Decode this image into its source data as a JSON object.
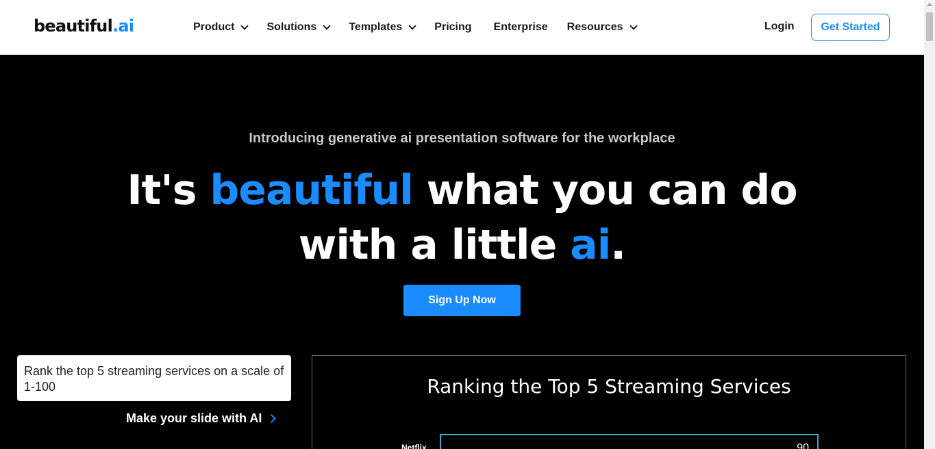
{
  "header": {
    "logo_main": "beautiful",
    "logo_dot": ".ai",
    "nav": [
      {
        "label": "Product",
        "dropdown": true
      },
      {
        "label": "Solutions",
        "dropdown": true
      },
      {
        "label": "Templates",
        "dropdown": true
      },
      {
        "label": "Pricing",
        "dropdown": false
      },
      {
        "label": "Enterprise",
        "dropdown": false
      },
      {
        "label": "Resources",
        "dropdown": true
      }
    ],
    "login_label": "Login",
    "get_started_label": "Get Started"
  },
  "hero": {
    "intro": "Introducing generative ai presentation software for the workplace",
    "headline_part1": "It's ",
    "headline_blue1": "beautiful",
    "headline_part2": " what you can do",
    "headline_part3": "with a little ",
    "headline_blue2": "ai",
    "headline_end": ".",
    "signup_label": "Sign Up Now"
  },
  "demo": {
    "prompt_text": "Rank the top 5 streaming services on a scale of 1-100",
    "make_slide_label": "Make your slide with AI",
    "slide_title": "Ranking the Top 5 Streaming Services",
    "first_bar_label": "Netflix",
    "first_bar_value": "90"
  },
  "colors": {
    "accent": "#1a8cff",
    "background": "#000000",
    "header_bg": "#ffffff",
    "bar_outline": "#3aa6c9"
  }
}
